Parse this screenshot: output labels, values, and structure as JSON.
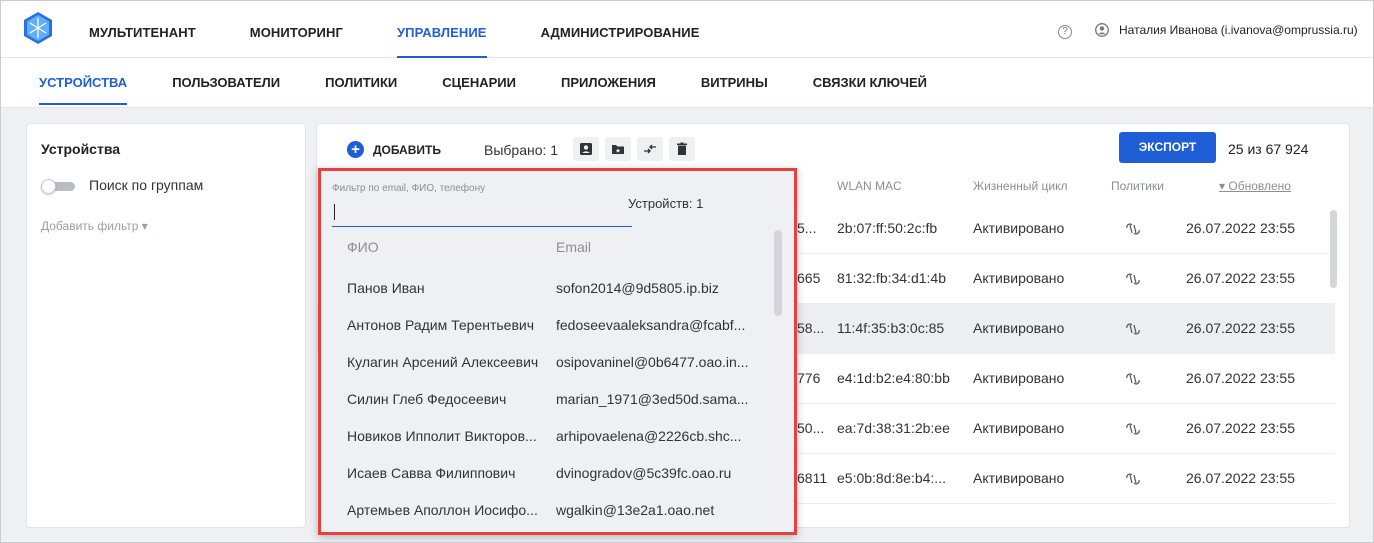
{
  "topnav": {
    "items": [
      "МУЛЬТИТЕНАНТ",
      "МОНИТОРИНГ",
      "УПРАВЛЕНИЕ",
      "АДМИНИСТРИРОВАНИЕ"
    ],
    "active": 2,
    "help_icon": "?",
    "user": "Наталия Иванова (i.ivanova@omprussia.ru)"
  },
  "subnav": {
    "items": [
      "УСТРОЙСТВА",
      "ПОЛЬЗОВАТЕЛИ",
      "ПОЛИТИКИ",
      "СЦЕНАРИИ",
      "ПРИЛОЖЕНИЯ",
      "ВИТРИНЫ",
      "СВЯЗКИ КЛЮЧЕЙ"
    ],
    "active": 0
  },
  "left": {
    "title": "Устройства",
    "toggle_label": "Поиск по группам",
    "add_filter": "Добавить фильтр ▾"
  },
  "toolbar": {
    "add": "ДОБАВИТЬ",
    "selected": "Выбрано: 1",
    "export": "ЭКСПОРТ",
    "count": "25 из 67 924"
  },
  "columns": {
    "wlan": "WLAN MAC",
    "lifecycle": "Жизненный цикл",
    "policies": "Политики",
    "updated": "▾ Обновлено"
  },
  "rows": [
    {
      "prefix": "5...",
      "wlan": "2b:07:ff:50:2c:fb",
      "state": "Активировано",
      "updated": "26.07.2022 23:55"
    },
    {
      "prefix": "665",
      "wlan": "81:32:fb:34:d1:4b",
      "state": "Активировано",
      "updated": "26.07.2022 23:55"
    },
    {
      "prefix": "58...",
      "wlan": "11:4f:35:b3:0c:85",
      "state": "Активировано",
      "updated": "26.07.2022 23:55"
    },
    {
      "prefix": "776",
      "wlan": "e4:1d:b2:e4:80:bb",
      "state": "Активировано",
      "updated": "26.07.2022 23:55"
    },
    {
      "prefix": "50...",
      "wlan": "ea:7d:38:31:2b:ee",
      "state": "Активировано",
      "updated": "26.07.2022 23:55"
    },
    {
      "prefix": "6811",
      "wlan": "e5:0b:8d:8e:b4:...",
      "state": "Активировано",
      "updated": "26.07.2022 23:55"
    }
  ],
  "popup": {
    "filter_label": "Фильтр по email, ФИО, телефону",
    "filter_value": "",
    "device_count": "Устройств: 1",
    "header_name": "ФИО",
    "header_email": "Email",
    "users": [
      {
        "name": "Панов Иван",
        "email": "sofon2014@9d5805.ip.biz"
      },
      {
        "name": "Антонов Радим Терентьевич",
        "email": "fedoseevaaleksandra@fcabf..."
      },
      {
        "name": "Кулагин Арсений Алексеевич",
        "email": "osipovaninel@0b6477.oao.in..."
      },
      {
        "name": "Силин Глеб Федосеевич",
        "email": "marian_1971@3ed50d.sama..."
      },
      {
        "name": "Новиков Ипполит Викторов...",
        "email": "arhipovaelena@2226cb.shc..."
      },
      {
        "name": "Исаев Савва Филиппович",
        "email": "dvinogradov@5c39fc.oao.ru"
      },
      {
        "name": "Артемьев Аполлон Иосифо...",
        "email": "wgalkin@13e2a1.oao.net"
      }
    ]
  }
}
